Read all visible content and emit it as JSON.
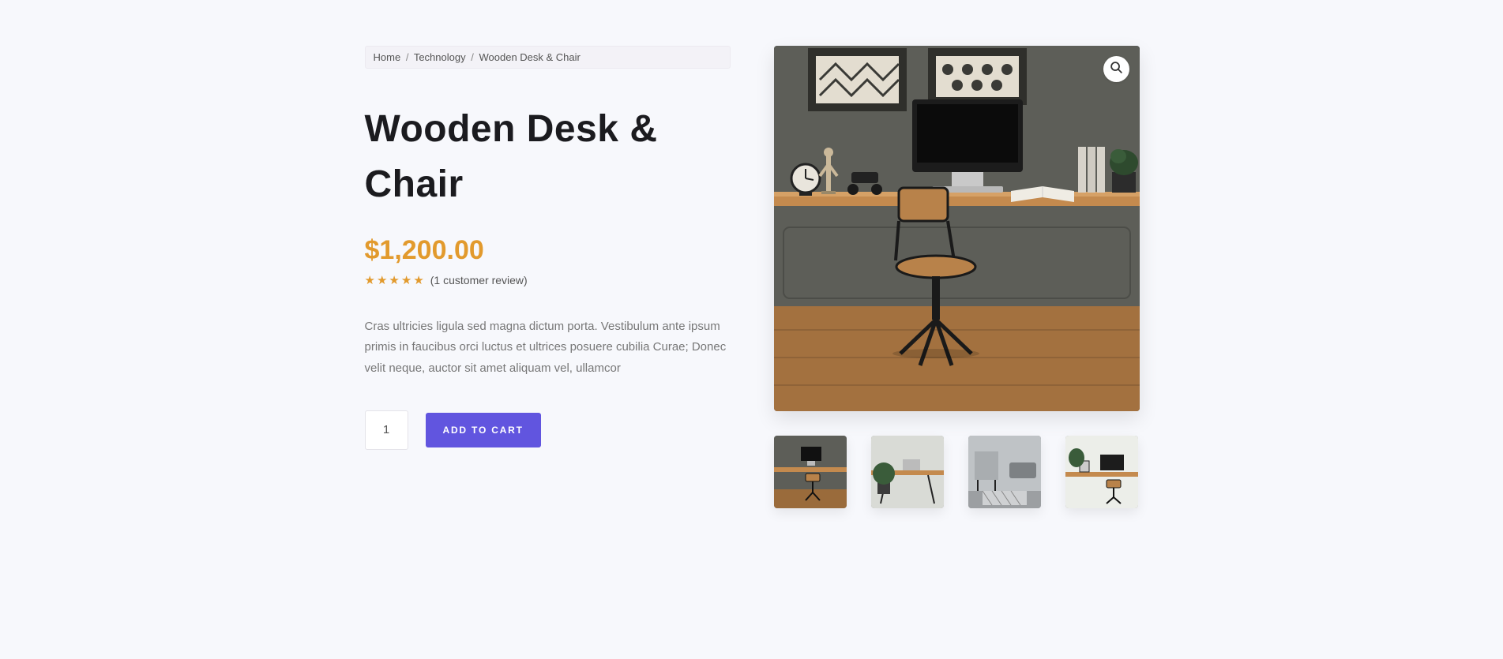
{
  "breadcrumb": {
    "home": "Home",
    "category": "Technology",
    "current": "Wooden Desk & Chair",
    "sep": "/"
  },
  "product": {
    "title": "Wooden Desk & Chair",
    "currency": "$",
    "price": "1,200.00",
    "reviews_text": "(1 customer review)",
    "rating": 5,
    "description": "Cras ultricies ligula sed magna dictum porta. Vestibulum ante ipsum primis in faucibus orci luctus et ultrices posuere cubilia Curae; Donec velit neque, auctor sit amet aliquam vel, ullamcor",
    "quantity": "1",
    "add_to_cart_label": "ADD TO CART"
  },
  "gallery": {
    "zoom_icon": "search-icon",
    "thumbnails": 4
  }
}
